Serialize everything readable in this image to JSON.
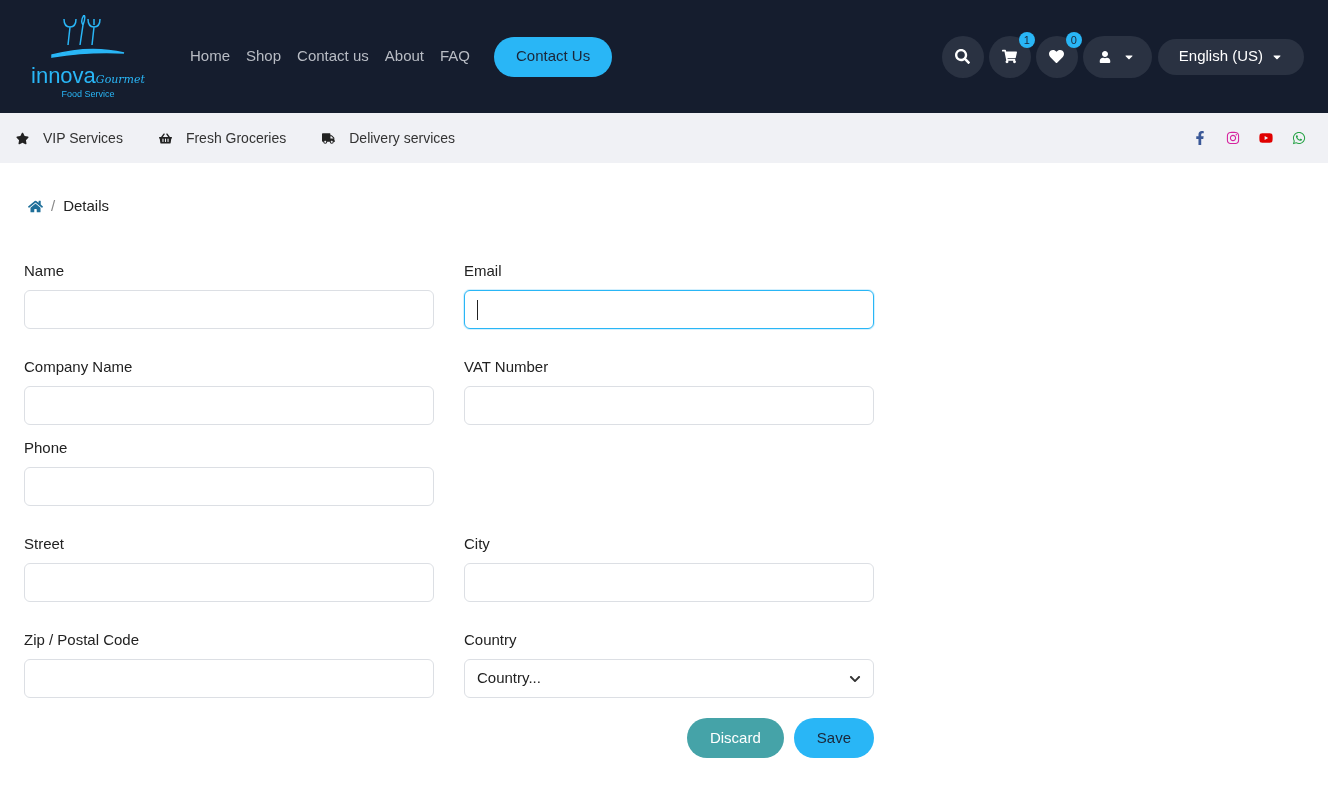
{
  "logo": {
    "brand": "innova",
    "script": "Gourmet",
    "tagline": "Food Service"
  },
  "nav": [
    "Home",
    "Shop",
    "Contact us",
    "About",
    "FAQ"
  ],
  "cta": "Contact Us",
  "actions": [
    {
      "kind": "search"
    },
    {
      "kind": "cart",
      "badge": "1"
    },
    {
      "kind": "wishlist",
      "badge": "0"
    },
    {
      "kind": "account"
    }
  ],
  "language": "English (US)",
  "features": [
    {
      "kind": "star",
      "label": "VIP Services"
    },
    {
      "kind": "basket",
      "label": "Fresh Groceries"
    },
    {
      "kind": "truck",
      "label": "Delivery services"
    }
  ],
  "social": [
    {
      "kind": "facebook"
    },
    {
      "kind": "instagram"
    },
    {
      "kind": "youtube"
    },
    {
      "kind": "whatsapp"
    }
  ],
  "breadcrumb": {
    "separator": "/",
    "current": "Details"
  },
  "form": {
    "sections": [
      [
        [
          {
            "label": "Name",
            "kind": "text",
            "focused": false
          },
          {
            "label": "Email",
            "kind": "text",
            "focused": true
          }
        ]
      ],
      [
        [
          {
            "label": "Company Name",
            "kind": "text",
            "focused": false
          },
          {
            "label": "VAT Number",
            "kind": "text",
            "focused": false
          }
        ],
        [
          {
            "label": "Phone",
            "kind": "text",
            "focused": false
          }
        ]
      ],
      [
        [
          {
            "label": "Street",
            "kind": "text",
            "focused": false
          },
          {
            "label": "City",
            "kind": "text",
            "focused": false
          }
        ]
      ],
      [
        [
          {
            "label": "Zip / Postal Code",
            "kind": "text",
            "focused": false
          },
          {
            "label": "Country",
            "kind": "select",
            "placeholder": "Country...",
            "focused": false
          }
        ]
      ]
    ]
  },
  "buttons": [
    {
      "kind": "secondary",
      "label": "Discard"
    },
    {
      "kind": "primary",
      "label": "Save"
    }
  ]
}
